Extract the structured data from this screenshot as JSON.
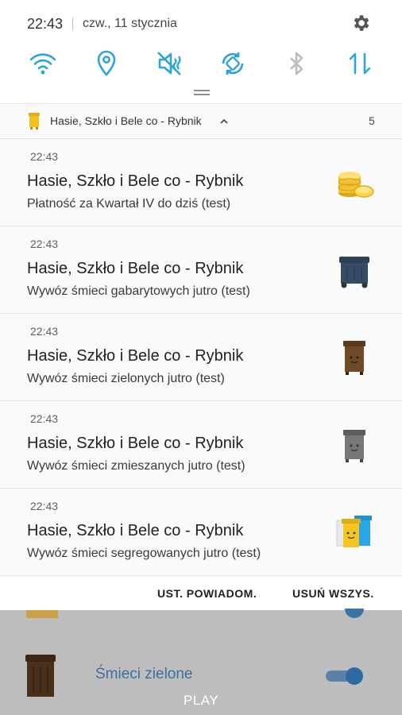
{
  "status_bar": {
    "time": "22:43",
    "date": "czw., 11 stycznia"
  },
  "quick_settings": [
    {
      "icon": "wifi-icon",
      "state": "on"
    },
    {
      "icon": "location-icon",
      "state": "on"
    },
    {
      "icon": "sound-off-icon",
      "state": "on"
    },
    {
      "icon": "auto-rotate-icon",
      "state": "on"
    },
    {
      "icon": "bluetooth-icon",
      "state": "off"
    },
    {
      "icon": "data-transfer-icon",
      "state": "on"
    }
  ],
  "colors": {
    "accent": "#2fa3d8",
    "inactive": "#bdbdbd",
    "text": "#222222",
    "app_link": "#3f6f9a"
  },
  "group": {
    "app_name": "Hasie, Szkło i Bele co - Rybnik",
    "count": "5"
  },
  "notifications": [
    {
      "time": "22:43",
      "title": "Hasie, Szkło i Bele co - Rybnik",
      "text": "Płatność za Kwartał IV do dziś (test)",
      "icon": "coins-icon"
    },
    {
      "time": "22:43",
      "title": "Hasie, Szkło i Bele co - Rybnik",
      "text": "Wywóz śmieci gabarytowych jutro (test)",
      "icon": "navy-bin-icon"
    },
    {
      "time": "22:43",
      "title": "Hasie, Szkło i Bele co - Rybnik",
      "text": "Wywóz śmieci zielonych jutro (test)",
      "icon": "brown-bin-icon"
    },
    {
      "time": "22:43",
      "title": "Hasie, Szkło i Bele co - Rybnik",
      "text": "Wywóz śmieci zmieszanych jutro (test)",
      "icon": "gray-bin-icon"
    },
    {
      "time": "22:43",
      "title": "Hasie, Szkło i Bele co - Rybnik",
      "text": "Wywóz śmieci segregowanych jutro (test)",
      "icon": "recycling-bins-icon"
    }
  ],
  "actions": {
    "settings": "UST. POWIADOM.",
    "clear_all": "USUŃ WSZYS."
  },
  "background_app": {
    "item_label": "Śmieci zielone",
    "toggle_on": true,
    "play_label": "PLAY"
  }
}
